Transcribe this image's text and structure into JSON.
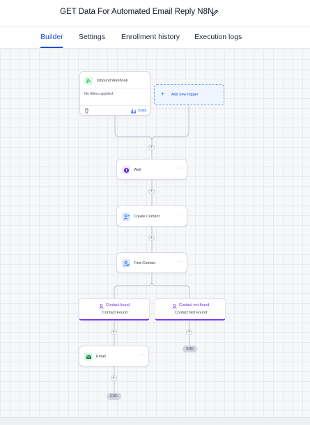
{
  "header": {
    "title": "GET Data For Automated Email Reply N8N",
    "edit_icon": "pencil-icon"
  },
  "tabs": [
    {
      "label": "Builder",
      "active": true
    },
    {
      "label": "Settings",
      "active": false
    },
    {
      "label": "Enrollment history",
      "active": false
    },
    {
      "label": "Execution logs",
      "active": false
    }
  ],
  "trigger": {
    "label": "Inbound Webhook",
    "filter_text": "No filters applied",
    "stats_label": "Stats",
    "add_trigger_label": "Add new trigger"
  },
  "steps": [
    {
      "label": "Wait",
      "icon": "clock-icon"
    },
    {
      "label": "Create Contact",
      "icon": "add-user-icon"
    },
    {
      "label": "Find Contact",
      "icon": "find-user-icon"
    }
  ],
  "branches": [
    {
      "title": "Contact found",
      "subtitle": "Contact Found"
    },
    {
      "title": "Contact not found",
      "subtitle": "Contact Not Found"
    }
  ],
  "email_step": {
    "label": "Email",
    "icon": "email-icon"
  },
  "end_label": "END",
  "colors": {
    "accent": "#1d4ed8",
    "branch_purple": "#7c3aed",
    "email_green": "#15803d"
  }
}
